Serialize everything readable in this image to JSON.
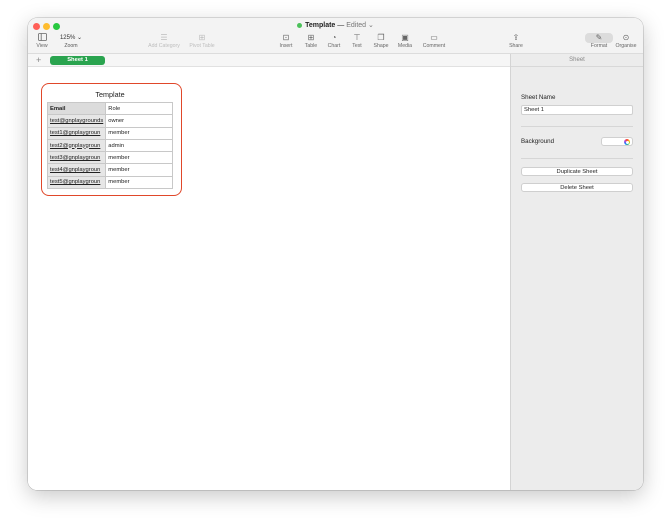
{
  "window": {
    "doc_name": "Template",
    "title_separator": "—",
    "edited_label": "Edited",
    "chevron": "⌄"
  },
  "toolbar": {
    "view": {
      "label": "View",
      "icon": "sidebar-icon"
    },
    "zoom": {
      "label": "Zoom",
      "value": "125% ⌄"
    },
    "add_category": {
      "label": "Add Category",
      "icon": "list-icon"
    },
    "pivot_table": {
      "label": "Pivot Table",
      "icon": "pivot-icon"
    },
    "insert": {
      "label": "Insert",
      "icon": "insert-icon"
    },
    "table": {
      "label": "Table",
      "icon": "table-icon"
    },
    "chart": {
      "label": "Chart",
      "icon": "chart-icon"
    },
    "text": {
      "label": "Text",
      "icon": "text-icon"
    },
    "shape": {
      "label": "Shape",
      "icon": "shape-icon"
    },
    "media": {
      "label": "Media",
      "icon": "media-icon"
    },
    "comment": {
      "label": "Comment",
      "icon": "comment-icon"
    },
    "share": {
      "label": "Share",
      "icon": "share-icon"
    },
    "format": {
      "label": "Format",
      "icon": "paintbrush-icon"
    },
    "organise": {
      "label": "Organise",
      "icon": "organise-icon"
    }
  },
  "tabs": {
    "add": "+",
    "sheets": [
      {
        "label": "Sheet 1"
      }
    ]
  },
  "table": {
    "title": "Template",
    "headers": [
      "Email",
      "Role"
    ],
    "rows": [
      [
        "test@gnplaygrounds",
        "owner"
      ],
      [
        "test1@gnplaygroun",
        "member"
      ],
      [
        "test2@gnplaygroun",
        "admin"
      ],
      [
        "test3@gnplaygroun",
        "member"
      ],
      [
        "test4@gnplaygroun",
        "member"
      ],
      [
        "test5@gnplaygroun",
        "member"
      ]
    ]
  },
  "sidebar": {
    "header": "Sheet",
    "sheet_name_label": "Sheet Name",
    "sheet_name_value": "Sheet 1",
    "background_label": "Background",
    "duplicate_button": "Duplicate Sheet",
    "delete_button": "Delete Sheet"
  },
  "colors": {
    "accent": "#2aa44f",
    "highlight": "#e0472a"
  }
}
